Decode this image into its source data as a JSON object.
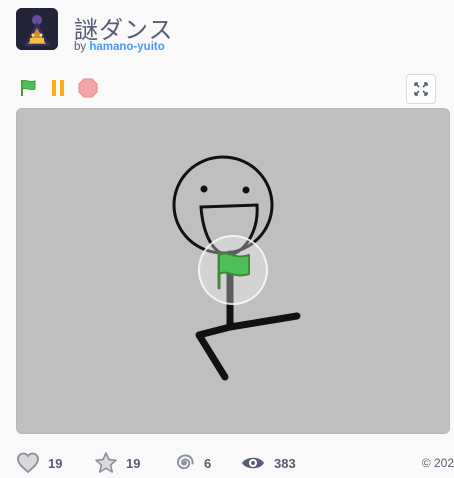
{
  "project": {
    "title": "謎ダンス",
    "by_prefix": "by",
    "author": "hamano-yuito"
  },
  "controls": {
    "green_flag_icon": "green-flag-icon",
    "pause_icon": "pause-icon",
    "stop_icon": "stop-icon",
    "fullscreen_icon": "fullscreen-icon"
  },
  "stats": {
    "loves": "19",
    "favorites": "19",
    "remixes": "6",
    "views": "383"
  },
  "footer": {
    "copyright": "© 202"
  },
  "colors": {
    "title_text": "#575e75",
    "author_link": "#4c97ff",
    "stage_bg": "#bfbfbf",
    "green_flag": "#4cbf56",
    "pause": "#ffab19",
    "stop": "#ec5959"
  }
}
